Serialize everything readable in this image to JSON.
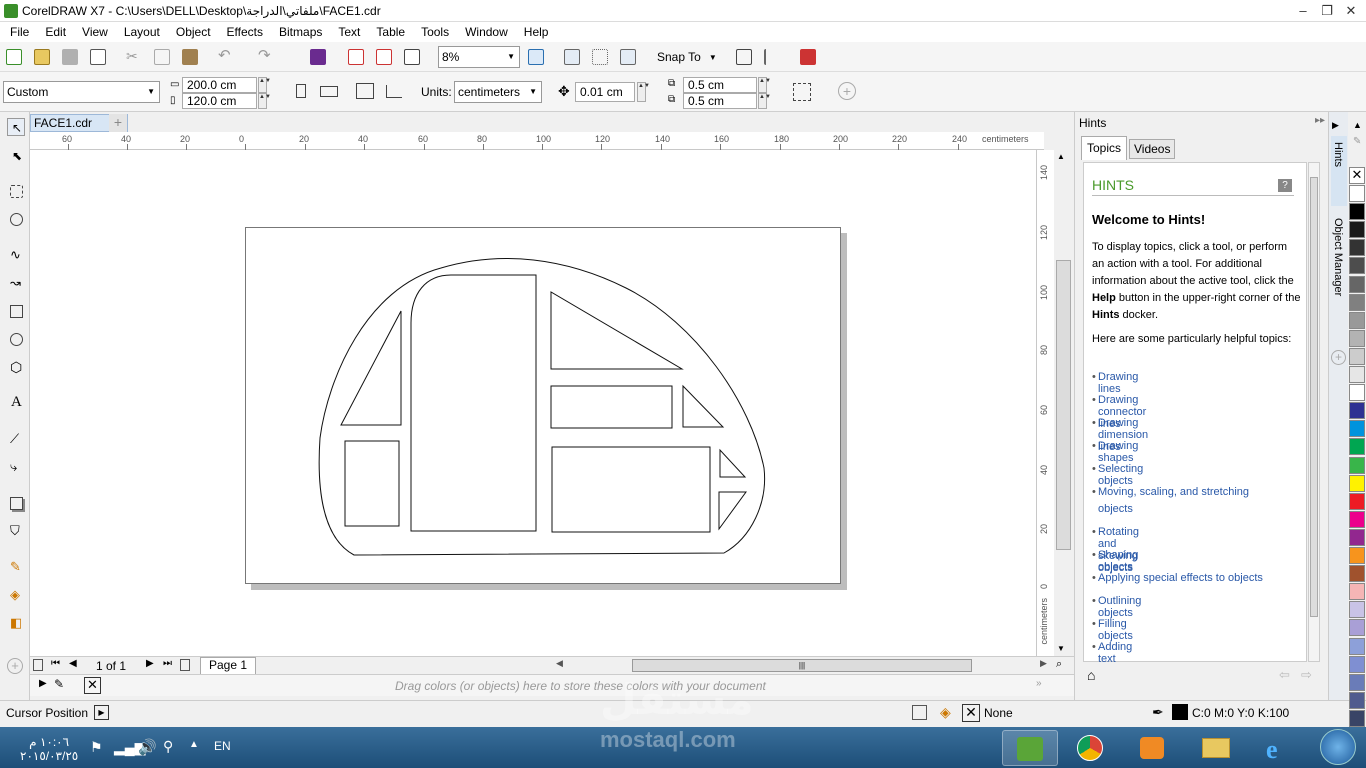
{
  "window": {
    "title": "CorelDRAW X7 - C:\\Users\\DELL\\Desktop\\ملفاتي\\الدراجة\\FACE1.cdr",
    "min": "–",
    "restore": "❐",
    "close": "✕"
  },
  "menu": [
    "File",
    "Edit",
    "View",
    "Layout",
    "Object",
    "Effects",
    "Bitmaps",
    "Text",
    "Table",
    "Tools",
    "Window",
    "Help"
  ],
  "toolbar": {
    "zoom": "8%",
    "snap": "Snap To"
  },
  "property_bar": {
    "preset": "Custom",
    "width": "200.0 cm",
    "height": "120.0 cm",
    "units_label": "Units:",
    "units": "centimeters",
    "nudge": "0.01 cm",
    "dup_x": "0.5 cm",
    "dup_y": "0.5 cm"
  },
  "document_tab": "FACE1.cdr",
  "ruler": {
    "h_ticks": [
      "60",
      "40",
      "20",
      "0",
      "20",
      "40",
      "60",
      "80",
      "100",
      "120",
      "140",
      "160",
      "180",
      "200",
      "220",
      "240"
    ],
    "h_unit": "centimeters",
    "v_ticks": [
      "140",
      "120",
      "100",
      "80",
      "60",
      "40",
      "20",
      "0"
    ],
    "v_unit": "centimeters"
  },
  "pager": {
    "count": "1 of 1",
    "page_tab": "Page 1"
  },
  "palette_hint": "Drag colors (or objects) here to store these colors with your document",
  "status": {
    "cursor": "Cursor Position",
    "fill": "None",
    "outline": "C:0 M:0 Y:0 K:100"
  },
  "hints": {
    "panel_title": "Hints",
    "tabs": [
      "Topics",
      "Videos"
    ],
    "heading": "HINTS",
    "welcome": "Welcome to Hints!",
    "intro_1": "To display topics, click a tool, or perform an action with a tool. For additional information about the active tool, click the ",
    "intro_help": "Help",
    "intro_2": " button in the upper-right corner of the ",
    "intro_hints": "Hints",
    "intro_3": " docker.",
    "topics_intro": "Here are some particularly helpful topics:",
    "topics": [
      "Drawing lines",
      "Drawing connector lines",
      "Drawing dimension lines",
      "Drawing shapes",
      "Selecting objects",
      "Moving, scaling, and stretching objects",
      "Rotating and skewing objects",
      "Shaping objects",
      "Applying special effects to objects",
      "Outlining objects",
      "Filling objects",
      "Adding text"
    ]
  },
  "docker_tabs": [
    "Hints",
    "Object Manager"
  ],
  "palette_colors": [
    "#ffffff",
    "#000000",
    "#1a1a1a",
    "#333333",
    "#4d4d4d",
    "#666666",
    "#808080",
    "#999999",
    "#b3b3b3",
    "#cccccc",
    "#e6e6e6",
    "#ffffff",
    "#2e3192",
    "#0093dd",
    "#00a651",
    "#39b54a",
    "#fff200",
    "#ed1c24",
    "#ec008c",
    "#92278f",
    "#f7941d",
    "#a0522d",
    "#f5b5b5",
    "#c9c3e6",
    "#a99fd6",
    "#8da0d9",
    "#7f8fd2",
    "#6a7cb8",
    "#505b8e",
    "#394466"
  ],
  "taskbar": {
    "time": "١٠:٠٦ م",
    "date": "٢٠١٥/٠٣/٢٥",
    "lang": "EN"
  },
  "watermark": {
    "arabic": "مستقل",
    "latin": "mostaql.com"
  }
}
